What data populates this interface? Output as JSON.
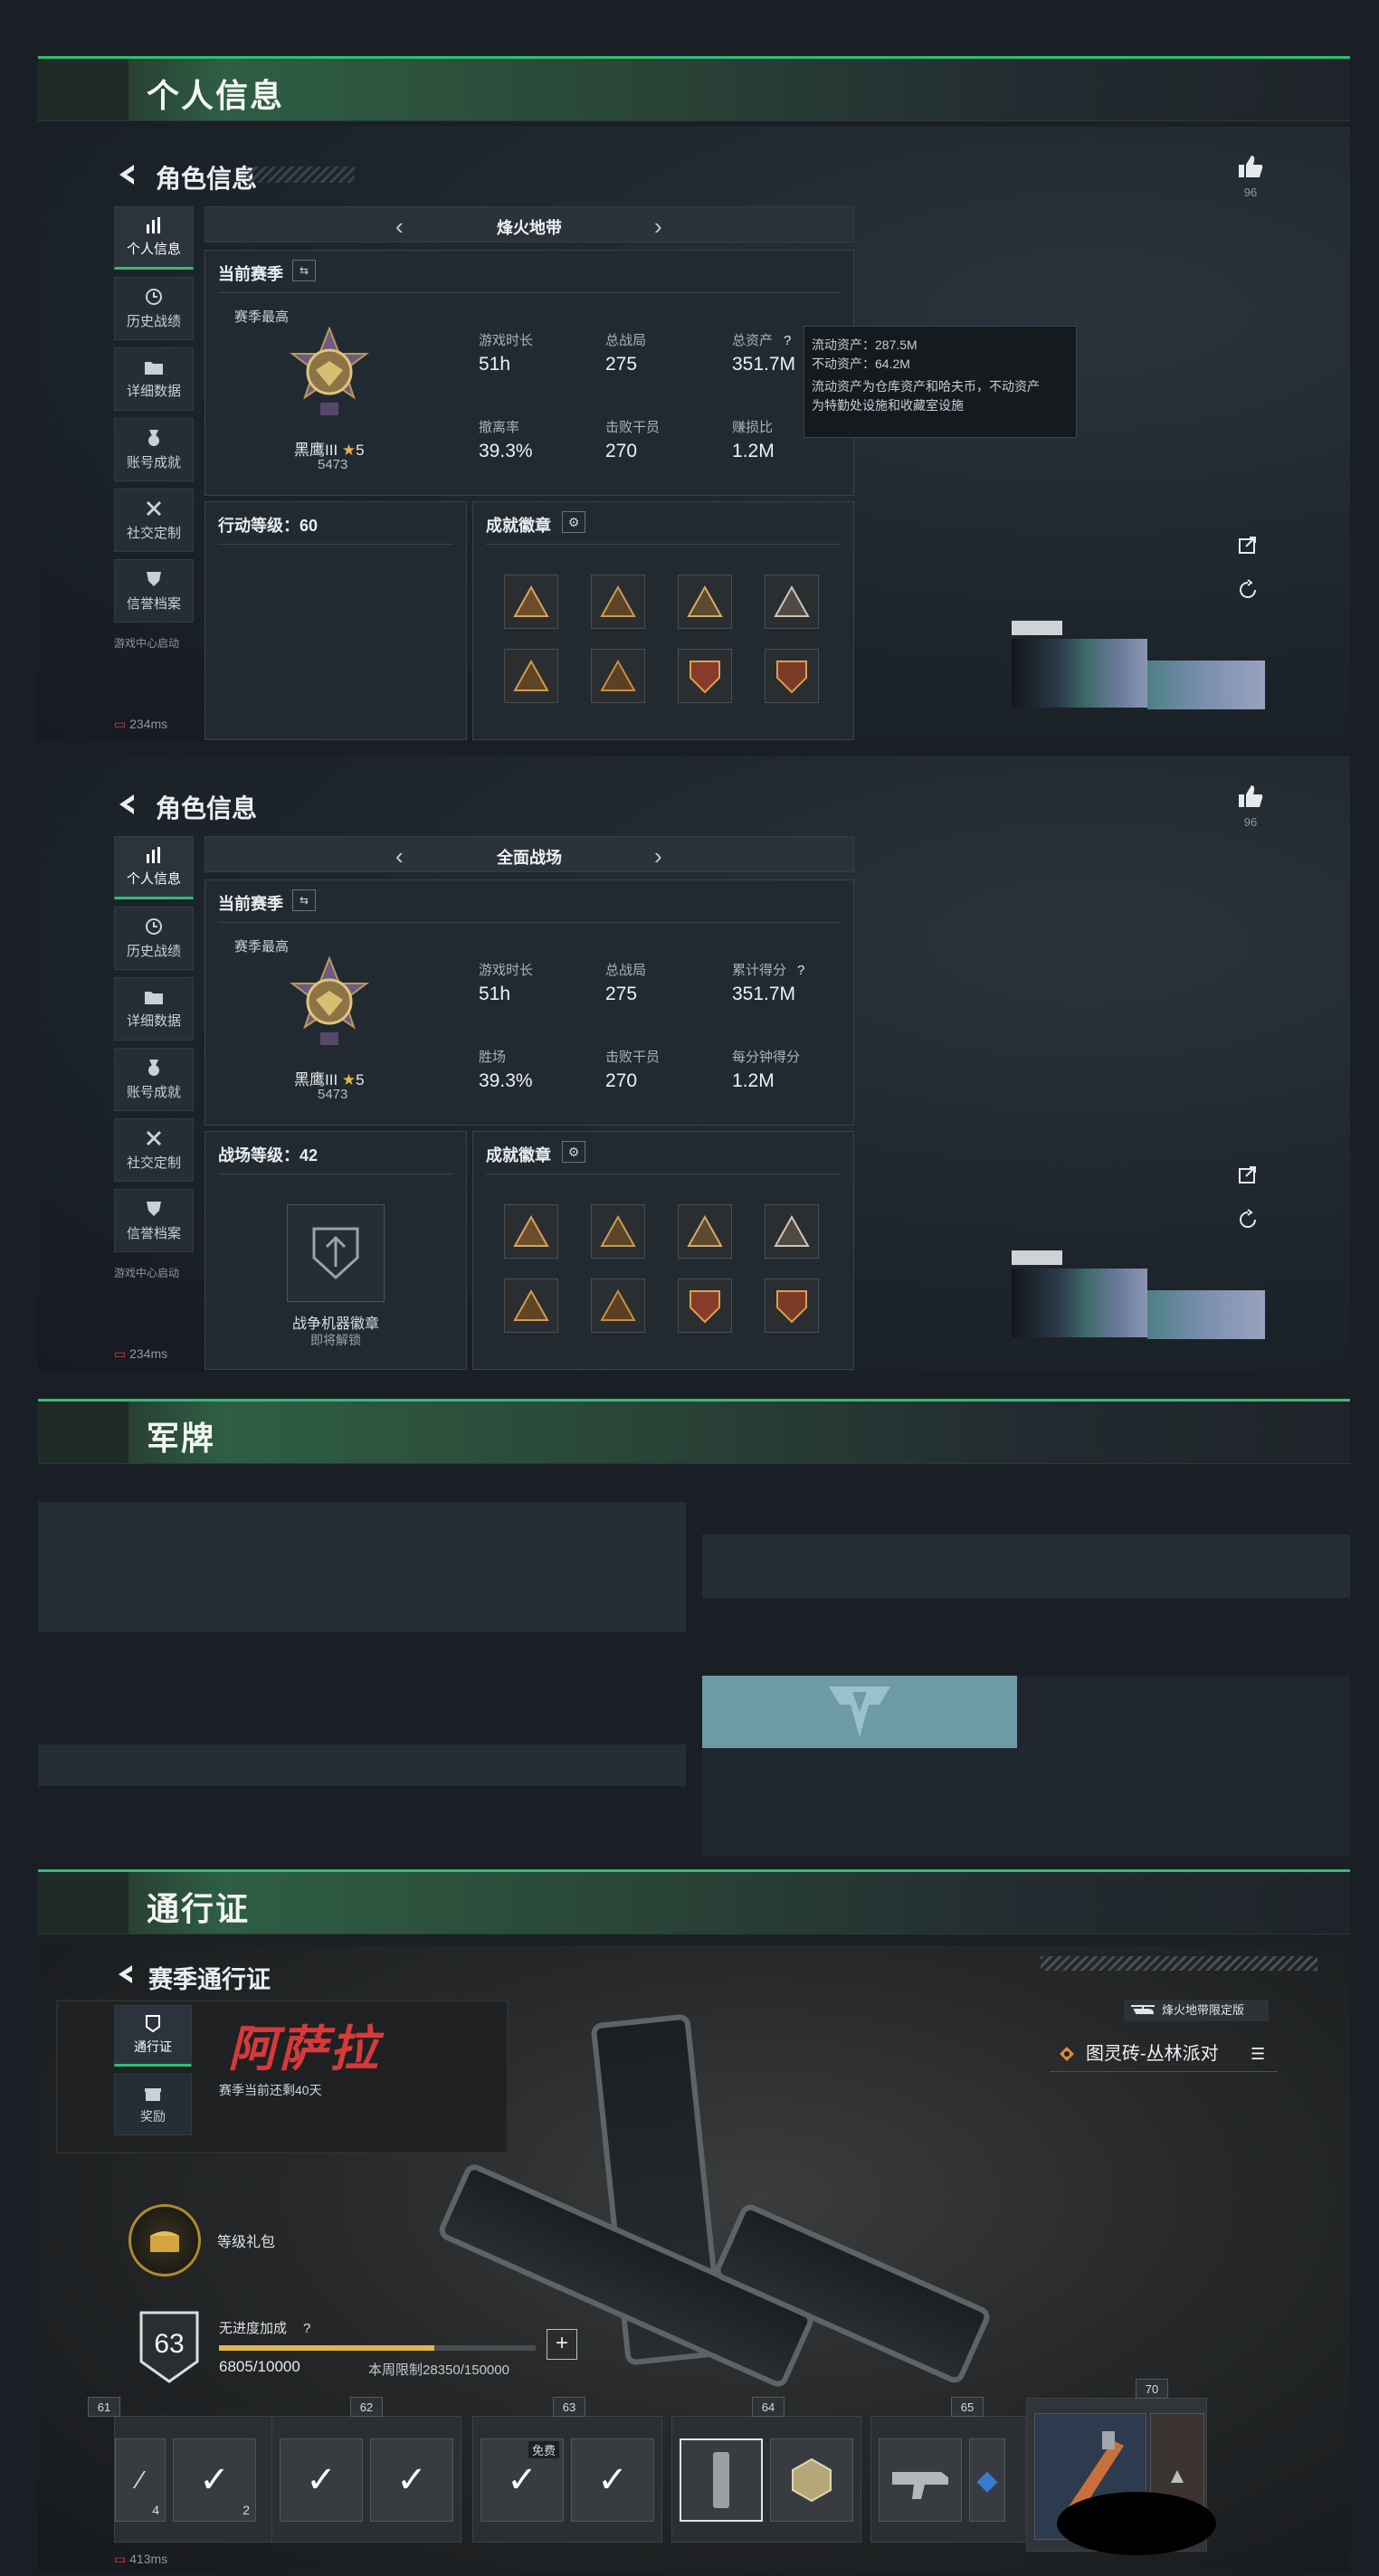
{
  "sections": {
    "personal_info": "个人信息",
    "military_tag": "军牌",
    "pass": "通行证"
  },
  "panel1": {
    "title": "角色信息",
    "nav": [
      "个人信息",
      "历史战绩",
      "详细数据",
      "账号成就",
      "社交定制",
      "信誉档案"
    ],
    "mode": "烽火地带",
    "current_season": "当前赛季",
    "season_best": "赛季最高",
    "rank_name": "黑鹰III",
    "rank_stars": "5",
    "rank_score": "5473",
    "stats": [
      {
        "label": "游戏时长",
        "value": "51h"
      },
      {
        "label": "总战局",
        "value": "275"
      },
      {
        "label": "总资产",
        "value": "351.7M"
      },
      {
        "label": "撤离率",
        "value": "39.3%"
      },
      {
        "label": "击败干员",
        "value": "270"
      },
      {
        "label": "赚损比",
        "value": "1.2M"
      }
    ],
    "level_label": "行动等级：60",
    "badges_label": "成就徽章",
    "like_count": "96",
    "footer": "游戏中心启动",
    "ping": "234ms",
    "tooltip": {
      "line1": "流动资产：287.5M",
      "line2": "不动资产：64.2M",
      "line3": "流动资产为仓库资产和哈夫币，不动资产",
      "line4": "为特勤处设施和收藏室设施"
    }
  },
  "panel2": {
    "title": "角色信息",
    "nav": [
      "个人信息",
      "历史战绩",
      "详细数据",
      "账号成就",
      "社交定制",
      "信誉档案"
    ],
    "mode": "全面战场",
    "current_season": "当前赛季",
    "season_best": "赛季最高",
    "rank_name": "黑鹰III",
    "rank_stars": "5",
    "rank_score": "5473",
    "stats": [
      {
        "label": "游戏时长",
        "value": "51h"
      },
      {
        "label": "总战局",
        "value": "275"
      },
      {
        "label": "累计得分",
        "value": "351.7M"
      },
      {
        "label": "胜场",
        "value": "39.3%"
      },
      {
        "label": "击败干员",
        "value": "270"
      },
      {
        "label": "每分钟得分",
        "value": "1.2M"
      }
    ],
    "level_label": "战场等级：42",
    "badges_label": "成就徽章",
    "war_badge_title": "战争机器徽章",
    "war_badge_sub": "即将解锁",
    "like_count": "96",
    "footer": "游戏中心启动",
    "ping": "234ms"
  },
  "pass": {
    "title": "赛季通行证",
    "nav": [
      "通行证",
      "奖励"
    ],
    "season_name": "阿萨拉",
    "season_remaining": "赛季当前还剩40天",
    "level_gift": "等级礼包",
    "level": "63",
    "progress_label": "无进度加成",
    "progress_value": "6805/10000",
    "progress_fraction": 0.6805,
    "weekly_cap": "本周限制28350/150000",
    "edition": "烽火地带限定版",
    "skin_name": "图灵砖-丛林派对",
    "free_label": "免费",
    "levels": [
      "61",
      "62",
      "63",
      "64",
      "65",
      "70"
    ],
    "slot_counts": [
      "4",
      "2"
    ],
    "ping": "413ms"
  },
  "colors": {
    "accent_green": "#2fbf71",
    "gold": "#e1b54a",
    "panel_bg": "#1d242b"
  }
}
